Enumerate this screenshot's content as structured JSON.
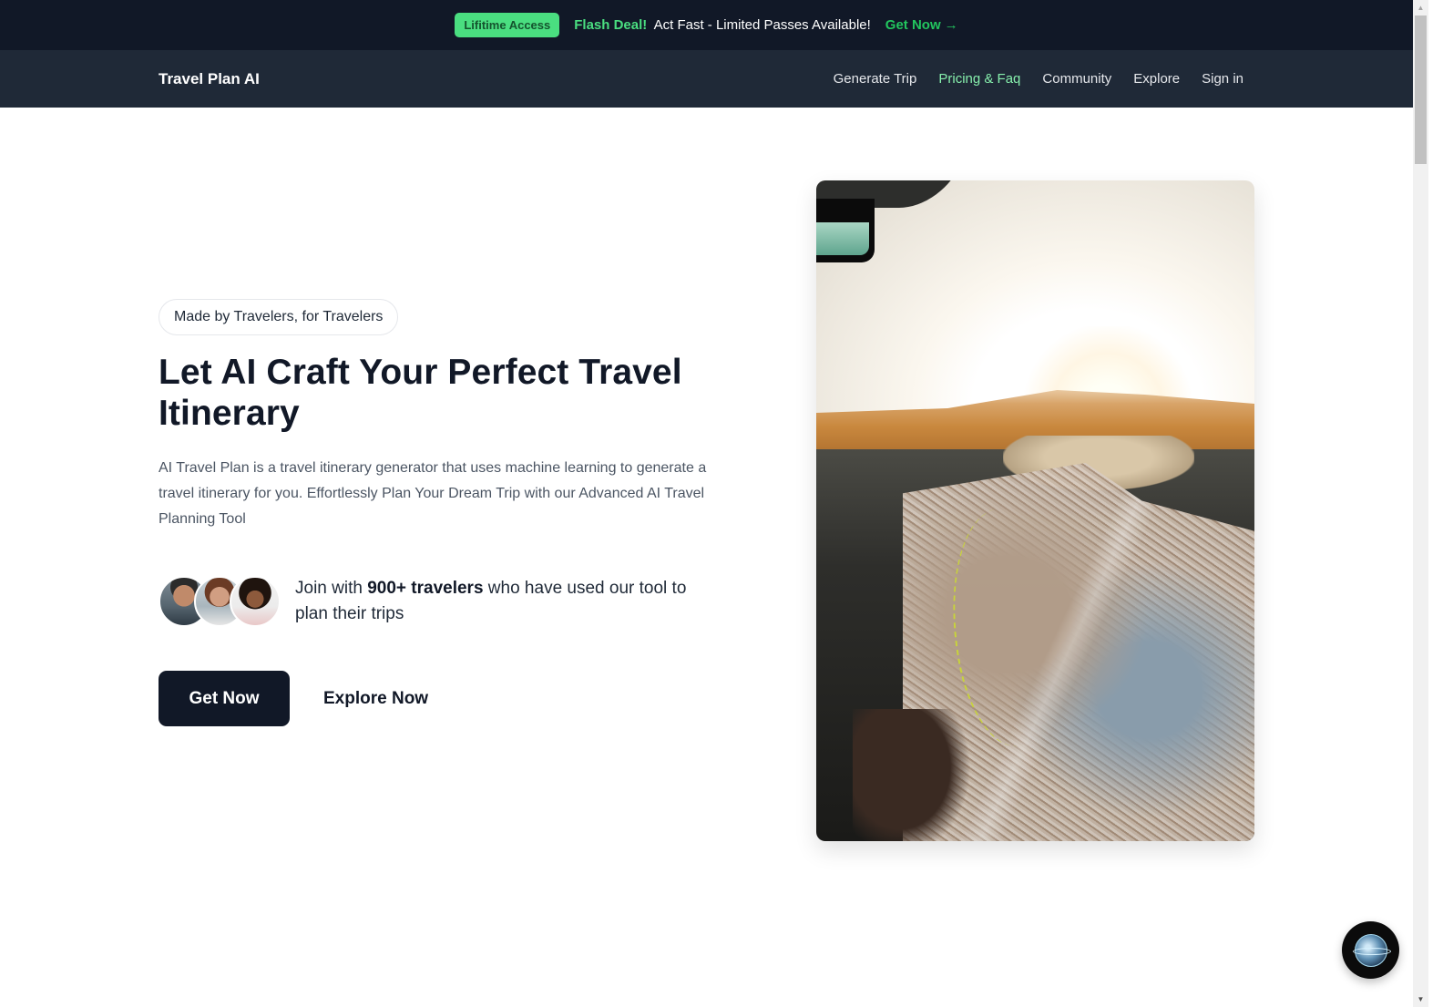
{
  "announcement": {
    "badge": "Lifitime Access",
    "flash_label": "Flash Deal!",
    "message": "Act Fast - Limited Passes Available!",
    "cta_label": "Get Now",
    "cta_icon": "arrow-right-icon",
    "cta_arrow": "→"
  },
  "navbar": {
    "brand": "Travel Plan AI",
    "links": [
      {
        "label": "Generate Trip",
        "active": false
      },
      {
        "label": "Pricing & Faq",
        "active": true
      },
      {
        "label": "Community",
        "active": false
      },
      {
        "label": "Explore",
        "active": false
      },
      {
        "label": "Sign in",
        "active": false
      }
    ]
  },
  "hero": {
    "pill": "Made by Travelers, for Travelers",
    "title": "Let AI Craft Your Perfect Travel Itinerary",
    "description": "AI Travel Plan is a travel itinerary generator that uses machine learning to generate a travel itinerary for you. Effortlessly Plan Your Dream Trip with our Advanced AI Travel Planning Tool",
    "social_proof": {
      "prefix": "Join with",
      "highlight": "900+ travelers",
      "suffix": "who have used our tool to plan their trips",
      "avatars": [
        "traveler-avatar-1",
        "traveler-avatar-2",
        "traveler-avatar-3"
      ]
    },
    "primary_cta": "Get Now",
    "secondary_cta": "Explore Now",
    "image_alt": "Map on car dashboard during a road trip"
  },
  "chat_widget": {
    "icon": "globe-chat-icon"
  },
  "colors": {
    "announce_bg": "#111827",
    "nav_bg": "#1f2937",
    "accent_green": "#4ade80",
    "active_link": "#86efac",
    "primary_button": "#111827"
  }
}
